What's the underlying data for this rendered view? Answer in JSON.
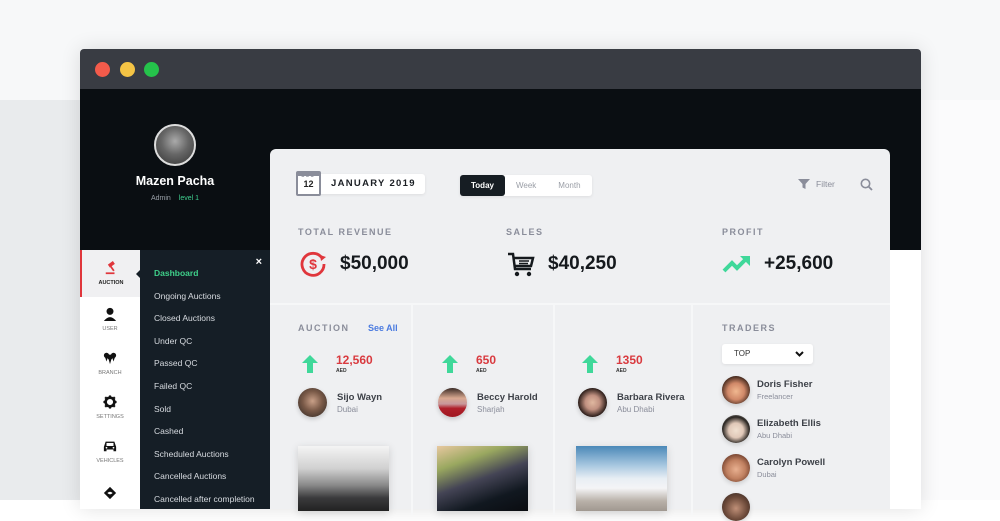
{
  "window": {
    "controls": [
      "close",
      "minimize",
      "maximize"
    ]
  },
  "profile": {
    "name": "Mazen Pacha",
    "role": "Admin",
    "level": "level 1"
  },
  "iconbar": [
    {
      "label": "AUCTION",
      "icon": "gavel-icon",
      "active": true
    },
    {
      "label": "USER",
      "icon": "user-icon"
    },
    {
      "label": "BRANCH",
      "icon": "branch-icon"
    },
    {
      "label": "SETTINGS",
      "icon": "gear-icon"
    },
    {
      "label": "Vehicles",
      "icon": "car-icon"
    },
    {
      "label": "",
      "icon": "handshake-icon"
    }
  ],
  "submenu": {
    "close_icon": "×",
    "items": [
      "Dashboard",
      "Ongoing Auctions",
      "Closed Auctions",
      "Under QC",
      "Passed QC",
      "Failed QC",
      "Sold",
      "Cashed",
      "Scheduled Auctions",
      "Cancelled Auctions",
      "Cancelled after completion"
    ]
  },
  "header": {
    "day": "12",
    "date": "JANUARY 2019",
    "periods": [
      "Today",
      "Week",
      "Month"
    ],
    "active_period": "Today",
    "filter_label": "Filter"
  },
  "stats": {
    "revenue": {
      "label": "TOTAL REVENUE",
      "value": "$50,000",
      "color": "#e0363c"
    },
    "sales": {
      "label": "SALES",
      "value": "$40,250"
    },
    "profit": {
      "label": "PROFIT",
      "value": "+25,600",
      "color": "#3fd89a"
    }
  },
  "auction": {
    "label": "AUCTION",
    "see_all": "See All",
    "items": [
      {
        "amount": "12,560",
        "currency": "AED",
        "name": "Sijo Wayn",
        "location": "Dubai"
      },
      {
        "amount": "650",
        "currency": "AED",
        "name": "Beccy Harold",
        "location": "Sharjah"
      },
      {
        "amount": "1350",
        "currency": "AED",
        "name": "Barbara Rivera",
        "location": "Abu Dhabi"
      }
    ]
  },
  "traders": {
    "label": "TRADERS",
    "filter_value": "TOP",
    "items": [
      {
        "name": "Doris Fisher",
        "sub": "Freelancer"
      },
      {
        "name": "Elizabeth Ellis",
        "sub": "Abu Dhabi"
      },
      {
        "name": "Carolyn Powell",
        "sub": "Dubai"
      }
    ]
  }
}
